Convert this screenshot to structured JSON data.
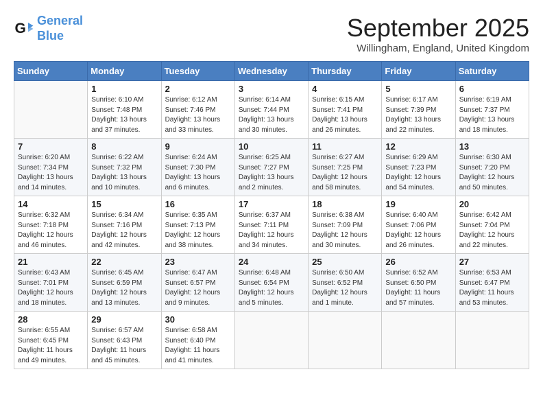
{
  "header": {
    "logo_line1": "General",
    "logo_line2": "Blue",
    "month": "September 2025",
    "location": "Willingham, England, United Kingdom"
  },
  "days_of_week": [
    "Sunday",
    "Monday",
    "Tuesday",
    "Wednesday",
    "Thursday",
    "Friday",
    "Saturday"
  ],
  "weeks": [
    [
      {
        "day": "",
        "info": ""
      },
      {
        "day": "1",
        "info": "Sunrise: 6:10 AM\nSunset: 7:48 PM\nDaylight: 13 hours\nand 37 minutes."
      },
      {
        "day": "2",
        "info": "Sunrise: 6:12 AM\nSunset: 7:46 PM\nDaylight: 13 hours\nand 33 minutes."
      },
      {
        "day": "3",
        "info": "Sunrise: 6:14 AM\nSunset: 7:44 PM\nDaylight: 13 hours\nand 30 minutes."
      },
      {
        "day": "4",
        "info": "Sunrise: 6:15 AM\nSunset: 7:41 PM\nDaylight: 13 hours\nand 26 minutes."
      },
      {
        "day": "5",
        "info": "Sunrise: 6:17 AM\nSunset: 7:39 PM\nDaylight: 13 hours\nand 22 minutes."
      },
      {
        "day": "6",
        "info": "Sunrise: 6:19 AM\nSunset: 7:37 PM\nDaylight: 13 hours\nand 18 minutes."
      }
    ],
    [
      {
        "day": "7",
        "info": "Sunrise: 6:20 AM\nSunset: 7:34 PM\nDaylight: 13 hours\nand 14 minutes."
      },
      {
        "day": "8",
        "info": "Sunrise: 6:22 AM\nSunset: 7:32 PM\nDaylight: 13 hours\nand 10 minutes."
      },
      {
        "day": "9",
        "info": "Sunrise: 6:24 AM\nSunset: 7:30 PM\nDaylight: 13 hours\nand 6 minutes."
      },
      {
        "day": "10",
        "info": "Sunrise: 6:25 AM\nSunset: 7:27 PM\nDaylight: 13 hours\nand 2 minutes."
      },
      {
        "day": "11",
        "info": "Sunrise: 6:27 AM\nSunset: 7:25 PM\nDaylight: 12 hours\nand 58 minutes."
      },
      {
        "day": "12",
        "info": "Sunrise: 6:29 AM\nSunset: 7:23 PM\nDaylight: 12 hours\nand 54 minutes."
      },
      {
        "day": "13",
        "info": "Sunrise: 6:30 AM\nSunset: 7:20 PM\nDaylight: 12 hours\nand 50 minutes."
      }
    ],
    [
      {
        "day": "14",
        "info": "Sunrise: 6:32 AM\nSunset: 7:18 PM\nDaylight: 12 hours\nand 46 minutes."
      },
      {
        "day": "15",
        "info": "Sunrise: 6:34 AM\nSunset: 7:16 PM\nDaylight: 12 hours\nand 42 minutes."
      },
      {
        "day": "16",
        "info": "Sunrise: 6:35 AM\nSunset: 7:13 PM\nDaylight: 12 hours\nand 38 minutes."
      },
      {
        "day": "17",
        "info": "Sunrise: 6:37 AM\nSunset: 7:11 PM\nDaylight: 12 hours\nand 34 minutes."
      },
      {
        "day": "18",
        "info": "Sunrise: 6:38 AM\nSunset: 7:09 PM\nDaylight: 12 hours\nand 30 minutes."
      },
      {
        "day": "19",
        "info": "Sunrise: 6:40 AM\nSunset: 7:06 PM\nDaylight: 12 hours\nand 26 minutes."
      },
      {
        "day": "20",
        "info": "Sunrise: 6:42 AM\nSunset: 7:04 PM\nDaylight: 12 hours\nand 22 minutes."
      }
    ],
    [
      {
        "day": "21",
        "info": "Sunrise: 6:43 AM\nSunset: 7:01 PM\nDaylight: 12 hours\nand 18 minutes."
      },
      {
        "day": "22",
        "info": "Sunrise: 6:45 AM\nSunset: 6:59 PM\nDaylight: 12 hours\nand 13 minutes."
      },
      {
        "day": "23",
        "info": "Sunrise: 6:47 AM\nSunset: 6:57 PM\nDaylight: 12 hours\nand 9 minutes."
      },
      {
        "day": "24",
        "info": "Sunrise: 6:48 AM\nSunset: 6:54 PM\nDaylight: 12 hours\nand 5 minutes."
      },
      {
        "day": "25",
        "info": "Sunrise: 6:50 AM\nSunset: 6:52 PM\nDaylight: 12 hours\nand 1 minute."
      },
      {
        "day": "26",
        "info": "Sunrise: 6:52 AM\nSunset: 6:50 PM\nDaylight: 11 hours\nand 57 minutes."
      },
      {
        "day": "27",
        "info": "Sunrise: 6:53 AM\nSunset: 6:47 PM\nDaylight: 11 hours\nand 53 minutes."
      }
    ],
    [
      {
        "day": "28",
        "info": "Sunrise: 6:55 AM\nSunset: 6:45 PM\nDaylight: 11 hours\nand 49 minutes."
      },
      {
        "day": "29",
        "info": "Sunrise: 6:57 AM\nSunset: 6:43 PM\nDaylight: 11 hours\nand 45 minutes."
      },
      {
        "day": "30",
        "info": "Sunrise: 6:58 AM\nSunset: 6:40 PM\nDaylight: 11 hours\nand 41 minutes."
      },
      {
        "day": "",
        "info": ""
      },
      {
        "day": "",
        "info": ""
      },
      {
        "day": "",
        "info": ""
      },
      {
        "day": "",
        "info": ""
      }
    ]
  ]
}
